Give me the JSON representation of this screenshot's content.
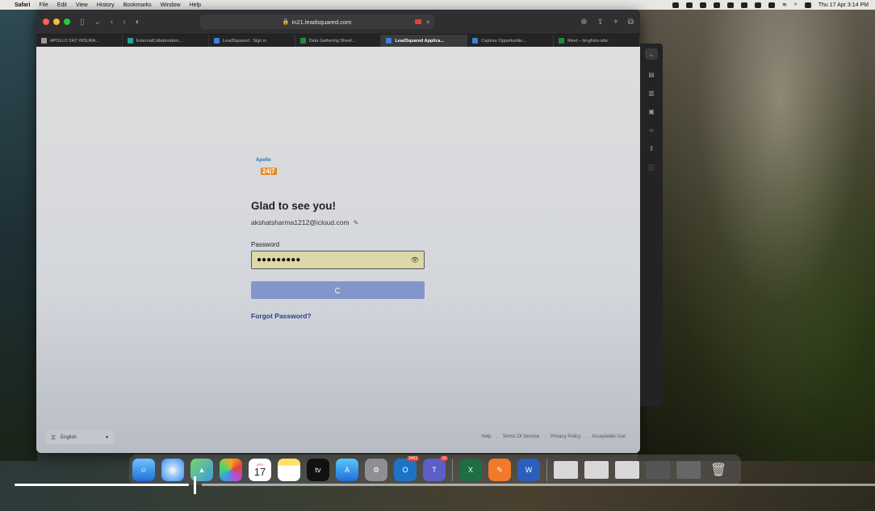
{
  "menubar": {
    "apple": "",
    "items": [
      "Safari",
      "File",
      "Edit",
      "View",
      "History",
      "Bookmarks",
      "Window",
      "Help"
    ],
    "clock": "Thu 17 Apr  3:14 PM"
  },
  "browser": {
    "address": "in21.leadsquared.com",
    "tabs": [
      {
        "label": "APOLLO 24|7 INSURA...",
        "color": "#9a9a9a"
      },
      {
        "label": "ExternalCollaboration...",
        "color": "#2aa198"
      },
      {
        "label": "LeadSquared : Sign in",
        "color": "#3b82d6"
      },
      {
        "label": "Data Gathering Sheet...",
        "color": "#1e8e3e"
      },
      {
        "label": "LeadSquared Applica...",
        "color": "#3b82d6"
      },
      {
        "label": "Capture Opportunitie...",
        "color": "#3b82d6"
      },
      {
        "label": "Meet – lxl-ghmz-wbc",
        "color": "#1e8e3e"
      }
    ]
  },
  "login": {
    "logo_line1": "Apollo",
    "logo_line2": "24|7",
    "greeting": "Glad to see you!",
    "email": "akshatsharma1212@icloud.com",
    "password_label": "Password",
    "password_mask": "●●●●●●●●●",
    "forgot": "Forgot Password?"
  },
  "footer": {
    "language": "English",
    "links": [
      "Help",
      "Terms Of Service",
      "Privacy Policy",
      "Acceptable Use"
    ]
  },
  "dock": {
    "calendar_month": "APR",
    "calendar_day": "17",
    "tv_label": "tv",
    "outlook_badge": "3463",
    "teams_badge": "10"
  },
  "colors": {
    "accent_button": "#8495c9",
    "link": "#2a3f86",
    "password_bg": "#ddd8a8"
  }
}
